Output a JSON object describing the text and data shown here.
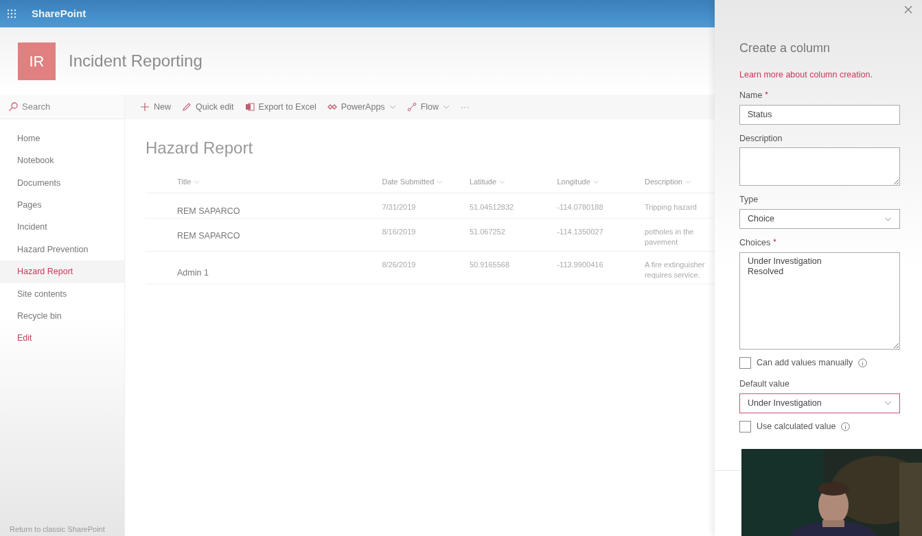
{
  "app_bar": {
    "title": "SharePoint"
  },
  "site": {
    "logo": "IR",
    "title": "Incident Reporting"
  },
  "search": {
    "placeholder": "Search"
  },
  "nav": [
    {
      "label": "Home",
      "selected": false
    },
    {
      "label": "Notebook",
      "selected": false
    },
    {
      "label": "Documents",
      "selected": false
    },
    {
      "label": "Pages",
      "selected": false
    },
    {
      "label": "Incident",
      "selected": false
    },
    {
      "label": "Hazard Prevention",
      "selected": false
    },
    {
      "label": "Hazard Report",
      "selected": true
    },
    {
      "label": "Site contents",
      "selected": false
    },
    {
      "label": "Recycle bin",
      "selected": false
    }
  ],
  "nav_edit": "Edit",
  "return_link": "Return to classic SharePoint",
  "commands": [
    {
      "kind": "new",
      "label": "New",
      "dropdown": false
    },
    {
      "kind": "edit",
      "label": "Quick edit",
      "dropdown": false
    },
    {
      "kind": "excel",
      "label": "Export to Excel",
      "dropdown": false
    },
    {
      "kind": "powerapps",
      "label": "PowerApps",
      "dropdown": true
    },
    {
      "kind": "flow",
      "label": "Flow",
      "dropdown": true
    },
    {
      "kind": "more",
      "label": "···"
    }
  ],
  "list": {
    "title": "Hazard Report",
    "columns": [
      "Title",
      "Date Submitted",
      "Latitude",
      "Longitude",
      "Description"
    ],
    "rows": [
      [
        "REM SAPARCO",
        "7/31/2019",
        "51.04512832",
        "-114.0780188",
        "Tripping hazard"
      ],
      [
        "REM SAPARCO",
        "8/16/2019",
        "51.067252",
        "-114.1350027",
        "potholes in the pavement"
      ],
      [
        "Admin 1",
        "8/26/2019",
        "50.9165568",
        "-113.9900416",
        "A fire extinguisher requires service."
      ]
    ]
  },
  "panel": {
    "title": "Create a column",
    "link": "Learn more about column creation.",
    "fields": [
      {
        "kind": "text",
        "label": "Name",
        "required": true,
        "value": "Status"
      },
      {
        "kind": "textarea",
        "label": "Description",
        "required": false
      },
      {
        "kind": "select",
        "label": "Type",
        "required": false,
        "value": "Choice",
        "focused": false
      },
      {
        "kind": "choices",
        "label": "Choices",
        "required": true,
        "lines": [
          "Under Investigation",
          "Resolved"
        ]
      },
      {
        "kind": "checkbox",
        "label": "Can add values manually",
        "checked": false
      },
      {
        "kind": "select",
        "label": "Default value",
        "required": false,
        "value": "Under Investigation",
        "focused": true
      },
      {
        "kind": "checkbox",
        "label": "Use calculated value",
        "checked": false
      }
    ]
  }
}
